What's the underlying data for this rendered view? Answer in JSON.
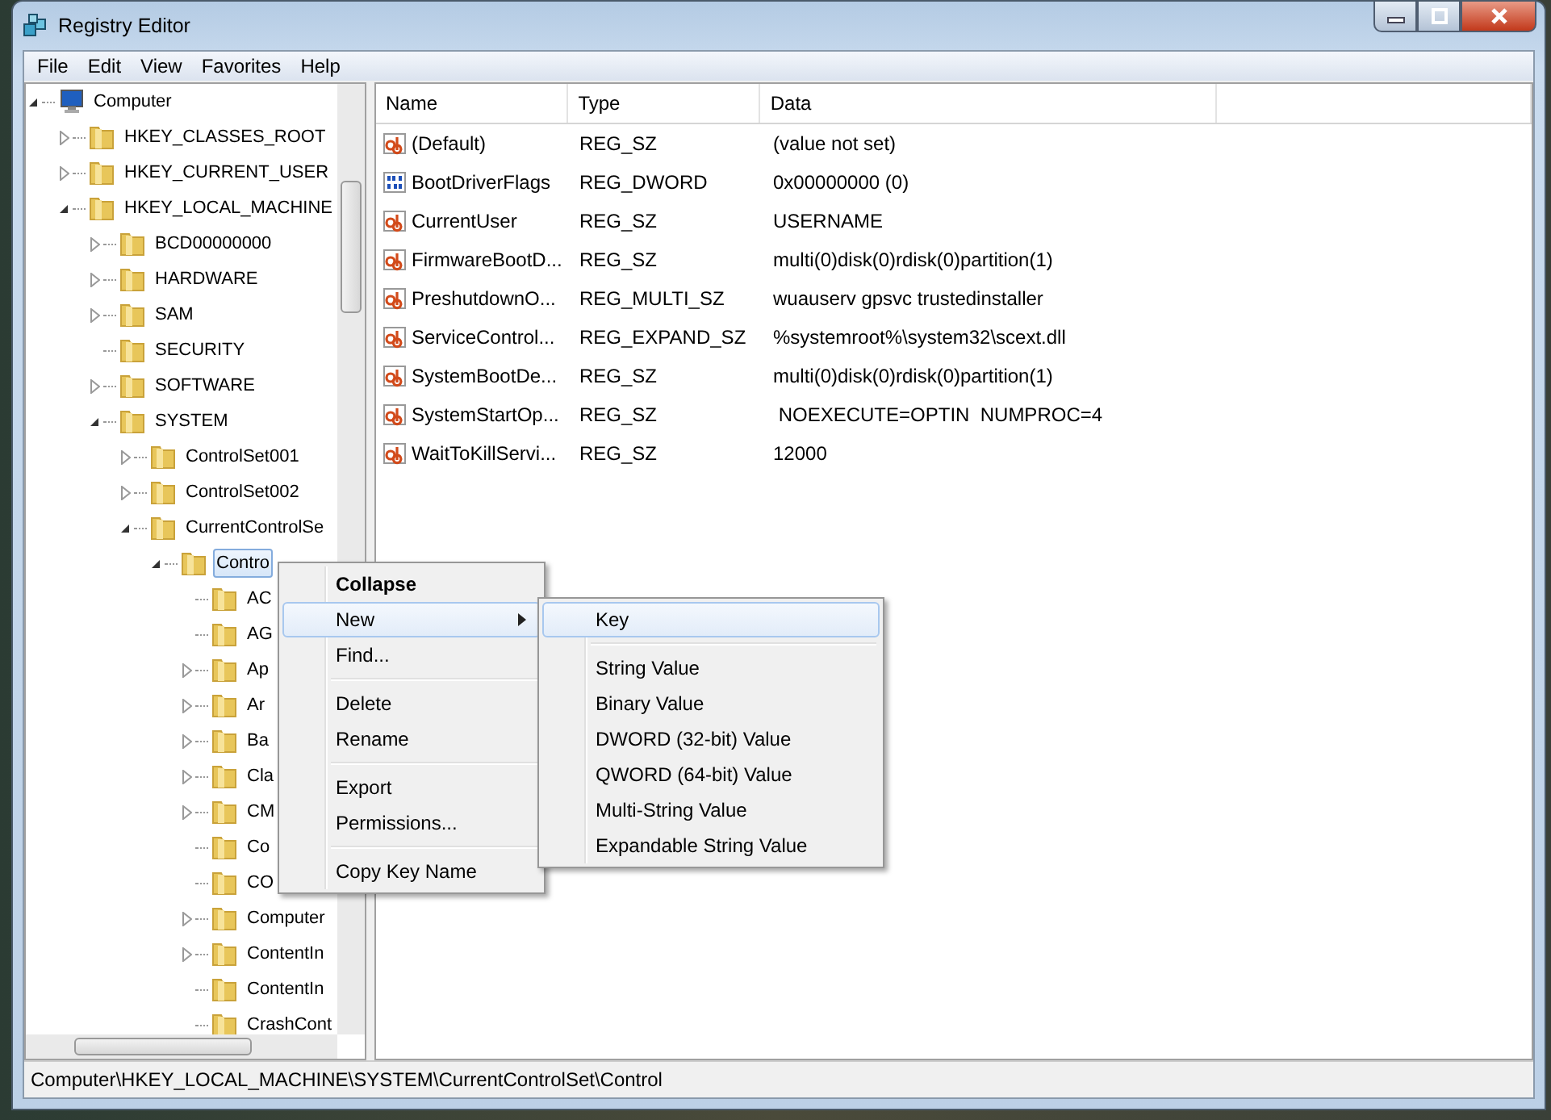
{
  "window": {
    "title": "Registry Editor"
  },
  "menu_bar": [
    "File",
    "Edit",
    "View",
    "Favorites",
    "Help"
  ],
  "tree": [
    {
      "label": "Computer",
      "kind": "computer",
      "expandable": true,
      "expanded": true,
      "selected": false,
      "children": [
        {
          "label": "HKEY_CLASSES_ROOT",
          "kind": "folder",
          "expandable": true,
          "expanded": false,
          "selected": false
        },
        {
          "label": "HKEY_CURRENT_USER",
          "kind": "folder",
          "expandable": true,
          "expanded": false,
          "selected": false
        },
        {
          "label": "HKEY_LOCAL_MACHINE",
          "kind": "folder",
          "expandable": true,
          "expanded": true,
          "selected": false,
          "children": [
            {
              "label": "BCD00000000",
              "kind": "folder",
              "expandable": true,
              "expanded": false,
              "selected": false
            },
            {
              "label": "HARDWARE",
              "kind": "folder",
              "expandable": true,
              "expanded": false,
              "selected": false
            },
            {
              "label": "SAM",
              "kind": "folder",
              "expandable": true,
              "expanded": false,
              "selected": false
            },
            {
              "label": "SECURITY",
              "kind": "folder",
              "expandable": false,
              "expanded": false,
              "selected": false
            },
            {
              "label": "SOFTWARE",
              "kind": "folder",
              "expandable": true,
              "expanded": false,
              "selected": false
            },
            {
              "label": "SYSTEM",
              "kind": "folder",
              "expandable": true,
              "expanded": true,
              "selected": false,
              "children": [
                {
                  "label": "ControlSet001",
                  "kind": "folder",
                  "expandable": true,
                  "expanded": false,
                  "selected": false
                },
                {
                  "label": "ControlSet002",
                  "kind": "folder",
                  "expandable": true,
                  "expanded": false,
                  "selected": false
                },
                {
                  "label": "CurrentControlSe",
                  "kind": "folder",
                  "expandable": true,
                  "expanded": true,
                  "selected": false,
                  "children": [
                    {
                      "label": "Contro",
                      "kind": "folder",
                      "expandable": true,
                      "expanded": true,
                      "selected": true,
                      "children": [
                        {
                          "label": "AC",
                          "kind": "folder",
                          "expandable": false,
                          "expanded": false,
                          "selected": false
                        },
                        {
                          "label": "AG",
                          "kind": "folder",
                          "expandable": false,
                          "expanded": false,
                          "selected": false
                        },
                        {
                          "label": "Ap",
                          "kind": "folder",
                          "expandable": true,
                          "expanded": false,
                          "selected": false
                        },
                        {
                          "label": "Ar",
                          "kind": "folder",
                          "expandable": true,
                          "expanded": false,
                          "selected": false
                        },
                        {
                          "label": "Ba",
                          "kind": "folder",
                          "expandable": true,
                          "expanded": false,
                          "selected": false
                        },
                        {
                          "label": "Cla",
                          "kind": "folder",
                          "expandable": true,
                          "expanded": false,
                          "selected": false
                        },
                        {
                          "label": "CM",
                          "kind": "folder",
                          "expandable": true,
                          "expanded": false,
                          "selected": false
                        },
                        {
                          "label": "Co",
                          "kind": "folder",
                          "expandable": false,
                          "expanded": false,
                          "selected": false
                        },
                        {
                          "label": "CO",
                          "kind": "folder",
                          "expandable": false,
                          "expanded": false,
                          "selected": false
                        },
                        {
                          "label": "Computer",
                          "kind": "folder",
                          "expandable": true,
                          "expanded": false,
                          "selected": false
                        },
                        {
                          "label": "ContentIn",
                          "kind": "folder",
                          "expandable": true,
                          "expanded": false,
                          "selected": false
                        },
                        {
                          "label": "ContentIn",
                          "kind": "folder",
                          "expandable": false,
                          "expanded": false,
                          "selected": false
                        },
                        {
                          "label": "CrashCont",
                          "kind": "folder",
                          "expandable": false,
                          "expanded": false,
                          "selected": false
                        }
                      ]
                    }
                  ]
                }
              ]
            }
          ]
        }
      ]
    }
  ],
  "table": {
    "columns": [
      "Name",
      "Type",
      "Data"
    ],
    "rows": [
      {
        "kind": "string",
        "name": "(Default)",
        "type": "REG_SZ",
        "data": "(value not set)"
      },
      {
        "kind": "binary",
        "name": "BootDriverFlags",
        "type": "REG_DWORD",
        "data": "0x00000000 (0)"
      },
      {
        "kind": "string",
        "name": "CurrentUser",
        "type": "REG_SZ",
        "data": "USERNAME"
      },
      {
        "kind": "string",
        "name": "FirmwareBootD...",
        "type": "REG_SZ",
        "data": "multi(0)disk(0)rdisk(0)partition(1)"
      },
      {
        "kind": "string",
        "name": "PreshutdownO...",
        "type": "REG_MULTI_SZ",
        "data": "wuauserv gpsvc trustedinstaller"
      },
      {
        "kind": "string",
        "name": "ServiceControl...",
        "type": "REG_EXPAND_SZ",
        "data": "%systemroot%\\system32\\scext.dll"
      },
      {
        "kind": "string",
        "name": "SystemBootDe...",
        "type": "REG_SZ",
        "data": "multi(0)disk(0)rdisk(0)partition(1)"
      },
      {
        "kind": "string",
        "name": "SystemStartOp...",
        "type": "REG_SZ",
        "data": " NOEXECUTE=OPTIN  NUMPROC=4"
      },
      {
        "kind": "string",
        "name": "WaitToKillServi...",
        "type": "REG_SZ",
        "data": "12000"
      }
    ]
  },
  "context_menu": [
    {
      "kind": "item",
      "label": "Collapse",
      "bold": true,
      "submenu": false,
      "selected": false
    },
    {
      "kind": "item",
      "label": "New",
      "bold": false,
      "submenu": true,
      "selected": true
    },
    {
      "kind": "item",
      "label": "Find...",
      "bold": false,
      "submenu": false,
      "selected": false
    },
    {
      "kind": "separator"
    },
    {
      "kind": "item",
      "label": "Delete",
      "bold": false,
      "submenu": false,
      "selected": false
    },
    {
      "kind": "item",
      "label": "Rename",
      "bold": false,
      "submenu": false,
      "selected": false
    },
    {
      "kind": "separator"
    },
    {
      "kind": "item",
      "label": "Export",
      "bold": false,
      "submenu": false,
      "selected": false
    },
    {
      "kind": "item",
      "label": "Permissions...",
      "bold": false,
      "submenu": false,
      "selected": false
    },
    {
      "kind": "separator"
    },
    {
      "kind": "item",
      "label": "Copy Key Name",
      "bold": false,
      "submenu": false,
      "selected": false
    }
  ],
  "submenu": [
    {
      "kind": "item",
      "label": "Key",
      "selected": true
    },
    {
      "kind": "separator"
    },
    {
      "kind": "item",
      "label": "String Value",
      "selected": false
    },
    {
      "kind": "item",
      "label": "Binary Value",
      "selected": false
    },
    {
      "kind": "item",
      "label": "DWORD (32-bit) Value",
      "selected": false
    },
    {
      "kind": "item",
      "label": "QWORD (64-bit) Value",
      "selected": false
    },
    {
      "kind": "item",
      "label": "Multi-String Value",
      "selected": false
    },
    {
      "kind": "item",
      "label": "Expandable String Value",
      "selected": false
    }
  ],
  "status_bar": "Computer\\HKEY_LOCAL_MACHINE\\SYSTEM\\CurrentControlSet\\Control"
}
